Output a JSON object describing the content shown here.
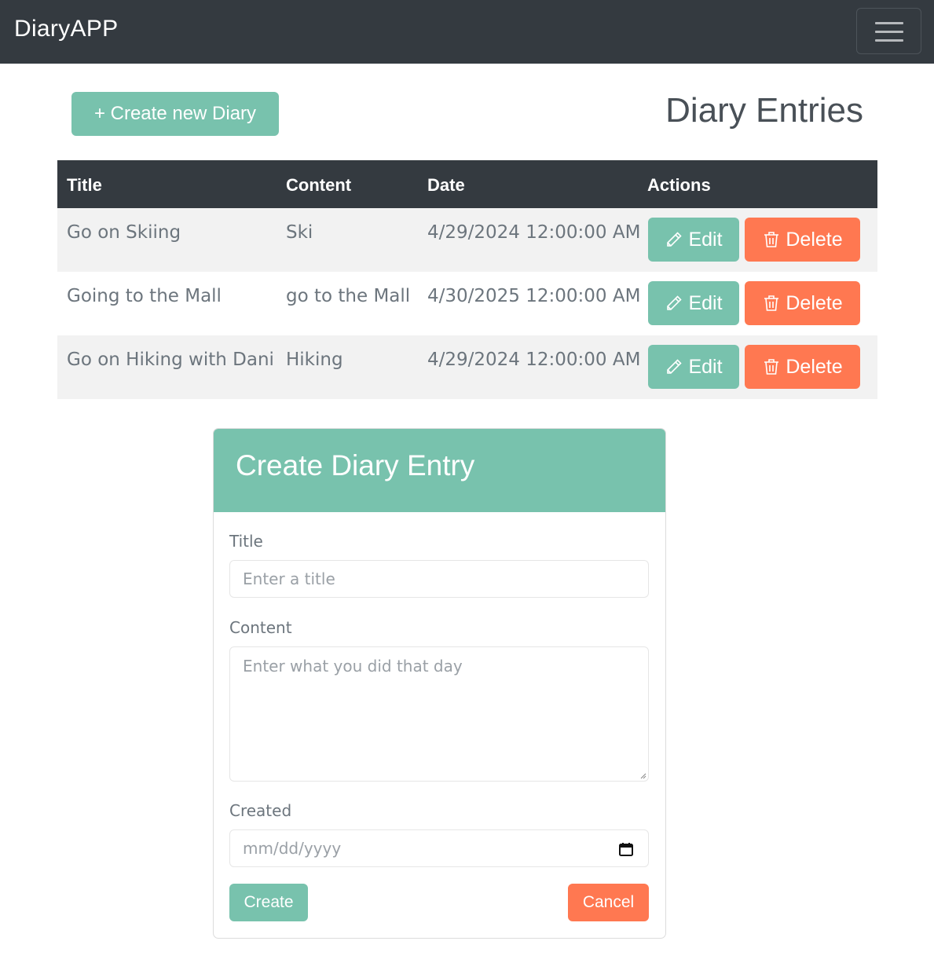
{
  "navbar": {
    "brand": "DiaryAPP",
    "menu_icon": "hamburger-icon"
  },
  "header": {
    "create_button": "+ Create new Diary",
    "title": "Diary Entries"
  },
  "table": {
    "columns": [
      "Title",
      "Content",
      "Date",
      "Actions"
    ],
    "rows": [
      {
        "title": "Go on Skiing",
        "content": "Ski",
        "date": "4/29/2024 12:00:00 AM"
      },
      {
        "title": "Going to the Mall",
        "content": "go to the Mall",
        "date": "4/30/2025 12:00:00 AM"
      },
      {
        "title": "Go on Hiking with Dani",
        "content": "Hiking",
        "date": "4/29/2024 12:00:00 AM"
      }
    ],
    "edit_label": "Edit",
    "delete_label": "Delete",
    "edit_icon": "pencil-icon",
    "delete_icon": "trash-icon"
  },
  "form": {
    "heading": "Create Diary Entry",
    "title_label": "Title",
    "title_placeholder": "Enter a title",
    "content_label": "Content",
    "content_placeholder": "Enter what you did that day",
    "created_label": "Created",
    "created_placeholder": "mm/dd/yyyy",
    "calendar_icon": "calendar-icon",
    "create_button": "Create",
    "cancel_button": "Cancel"
  },
  "colors": {
    "navbar": "#343a40",
    "primary": "#78c2ad",
    "danger": "#ff7851",
    "stripe": "#f2f2f2"
  }
}
